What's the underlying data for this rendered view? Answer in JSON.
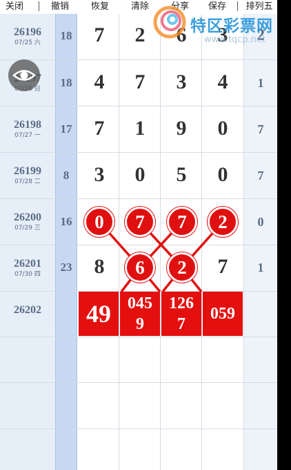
{
  "toolbar": {
    "close": "关闭",
    "undo": "撤销",
    "restore": "恢复",
    "clear": "清除",
    "share": "分享",
    "save": "保存",
    "pl5": "排列五"
  },
  "watermark": {
    "title": "特区彩票网",
    "url": "www.tqcp.net"
  },
  "rows": [
    {
      "issue": "26196",
      "date": "07/25 六",
      "sum": "18",
      "digits": [
        "7",
        "2",
        "6",
        "3"
      ],
      "last": "2"
    },
    {
      "issue": "26197",
      "date": "07/26 日",
      "sum": "18",
      "digits": [
        "4",
        "7",
        "3",
        "4"
      ],
      "last": "1"
    },
    {
      "issue": "26198",
      "date": "07/27 一",
      "sum": "17",
      "digits": [
        "7",
        "1",
        "9",
        "0"
      ],
      "last": "7"
    },
    {
      "issue": "26199",
      "date": "07/28 二",
      "sum": "8",
      "digits": [
        "3",
        "0",
        "5",
        "0"
      ],
      "last": "7"
    },
    {
      "issue": "26200",
      "date": "07/29 三",
      "sum": "16",
      "digits": [
        "0",
        "7",
        "7",
        "2"
      ],
      "last": "0"
    },
    {
      "issue": "26201",
      "date": "07/30 四",
      "sum": "23",
      "digits": [
        "8",
        "6",
        "2",
        "7"
      ],
      "last": "1"
    },
    {
      "issue": "26202",
      "date": "",
      "sum": "",
      "digits": [
        "",
        "",
        "",
        ""
      ],
      "last": ""
    }
  ],
  "predictions": {
    "col1": "49",
    "col2_top": "045",
    "col2_bottom": "9",
    "col3_top": "126",
    "col3_bottom": "7",
    "col4": "059"
  },
  "colors": {
    "accent_red": "#e01010",
    "issue_text": "#5a6b86",
    "sum_column": "#c6d8f2"
  }
}
